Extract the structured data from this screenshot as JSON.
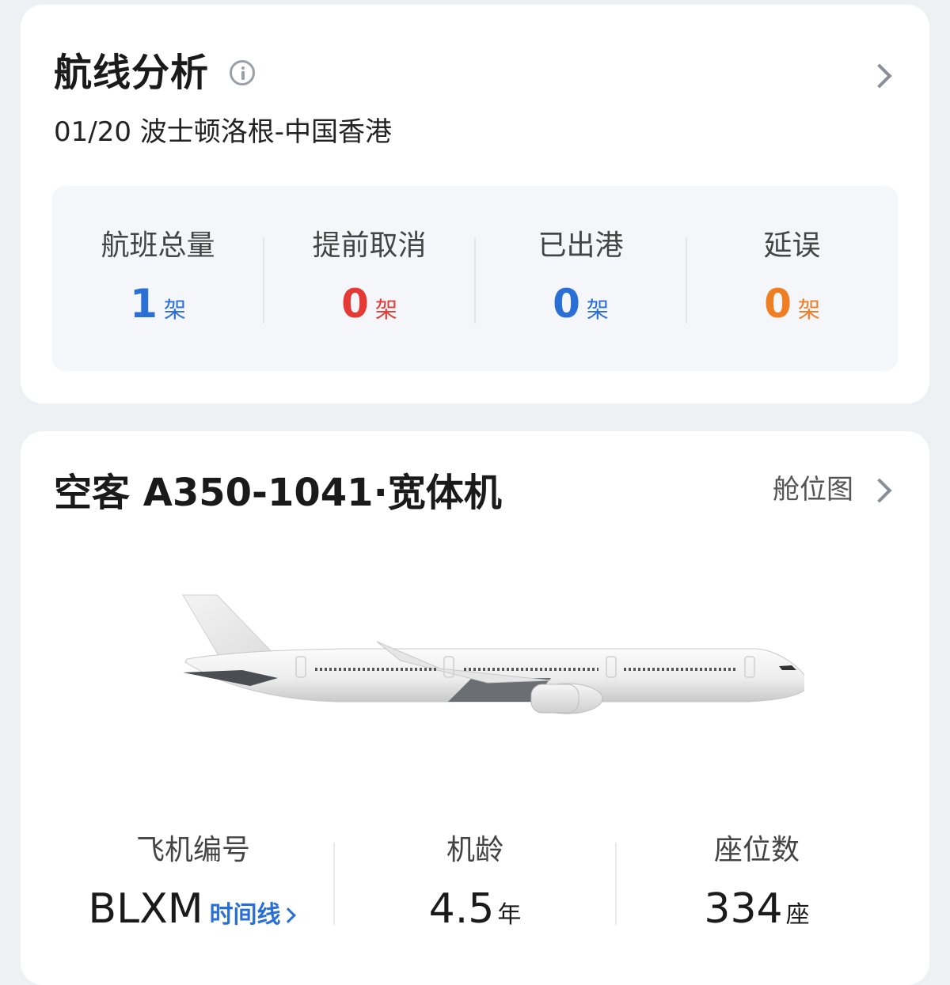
{
  "route": {
    "title": "航线分析",
    "subtitle": "01/20 波士顿洛根-中国香港",
    "stats": [
      {
        "label": "航班总量",
        "value": "1",
        "unit": "架",
        "color": "#2a6fd6"
      },
      {
        "label": "提前取消",
        "value": "0",
        "unit": "架",
        "color": "#e53935"
      },
      {
        "label": "已出港",
        "value": "0",
        "unit": "架",
        "color": "#2a6fd6"
      },
      {
        "label": "延误",
        "value": "0",
        "unit": "架",
        "color": "#ef7d22"
      }
    ]
  },
  "aircraft": {
    "title": "空客 A350-1041·宽体机",
    "seatmap_label": "舱位图",
    "registration": {
      "label": "飞机编号",
      "value": "BLXM",
      "link": "时间线"
    },
    "age": {
      "label": "机龄",
      "value": "4.5",
      "unit": "年"
    },
    "seats": {
      "label": "座位数",
      "value": "334",
      "unit": "座"
    }
  }
}
